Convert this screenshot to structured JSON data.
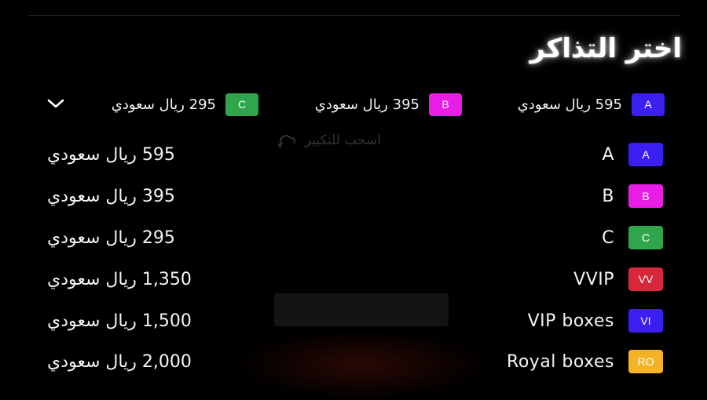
{
  "title": "اختر التذاكر",
  "hint_text": "اسحب للتكبير",
  "summary": [
    {
      "chip": "A",
      "price": "595 ريال سعودي",
      "color": "#3b1ff0"
    },
    {
      "chip": "B",
      "price": "395 ريال سعودي",
      "color": "#e91ee6"
    },
    {
      "chip": "C",
      "price": "295 ريال سعودي",
      "color": "#2fa54c"
    }
  ],
  "tickets": [
    {
      "chip": "A",
      "name": "A",
      "price": "595 ريال سعودي",
      "color": "#3b1ff0",
      "chip_text_color": "#ffffff"
    },
    {
      "chip": "B",
      "name": "B",
      "price": "395 ريال سعودي",
      "color": "#e91ee6",
      "chip_text_color": "#ffffff"
    },
    {
      "chip": "C",
      "name": "C",
      "price": "295 ريال سعودي",
      "color": "#2fa54c",
      "chip_text_color": "#ffffff"
    },
    {
      "chip": "VV",
      "name": "VVIP",
      "price": "1,350 ريال سعودي",
      "color": "#d8263b",
      "chip_text_color": "#ffffff"
    },
    {
      "chip": "VI",
      "name": "VIP boxes",
      "price": "1,500 ريال سعودي",
      "color": "#3b1ff0",
      "chip_text_color": "#ffffff"
    },
    {
      "chip": "RO",
      "name": "Royal boxes",
      "price": "2,000 ريال سعودي",
      "color": "#f3b325",
      "chip_text_color": "#ffffff"
    }
  ]
}
